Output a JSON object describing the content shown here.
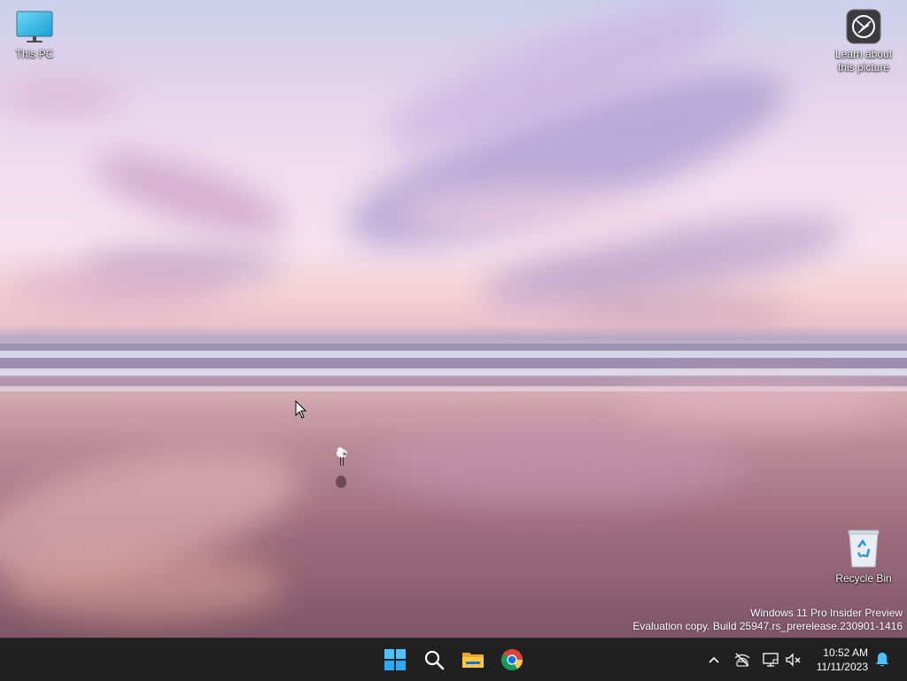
{
  "desktop_icons": {
    "this_pc": {
      "label": "This PC",
      "icon": "monitor-icon"
    },
    "learn_picture": {
      "label_line1": "Learn about",
      "label_line2": "this picture",
      "icon": "camera-aperture-icon"
    },
    "recycle_bin": {
      "label": "Recycle Bin",
      "icon": "recycle-bin-icon"
    }
  },
  "watermark": {
    "line1": "Windows 11 Pro Insider Preview",
    "line2": "Evaluation copy. Build 25947.rs_prerelease.230901-1416"
  },
  "taskbar": {
    "pinned": [
      {
        "name": "start",
        "icon": "windows-logo-icon"
      },
      {
        "name": "search",
        "icon": "search-icon"
      },
      {
        "name": "file-explorer",
        "icon": "folder-icon"
      },
      {
        "name": "chrome",
        "icon": "chrome-icon"
      }
    ],
    "tray": {
      "chevron": "chevron-up-icon",
      "network": "no-internet-icon",
      "display": "display-icon",
      "volume": "volume-muted-icon",
      "notifications": "bell-icon"
    },
    "clock": {
      "time": "10:52 AM",
      "date": "11/11/2023"
    }
  },
  "colors": {
    "taskbar_bg": "#202020",
    "accent_blue": "#0078d4",
    "icon_cyan": "#4cc2ff"
  }
}
